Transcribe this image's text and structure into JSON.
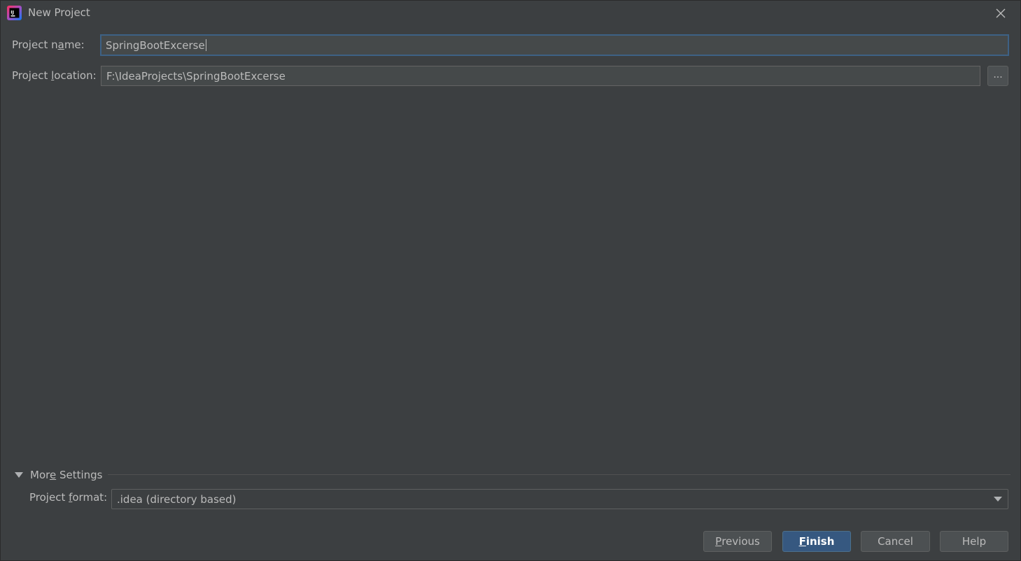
{
  "window": {
    "title": "New Project",
    "app_icon": "intellij-idea-icon",
    "close_icon": "close-icon"
  },
  "form": {
    "name_label_pre": "Project n",
    "name_label_mn": "a",
    "name_label_post": "me:",
    "name_value": "SpringBootExcerse",
    "location_label_pre": "Project ",
    "location_label_mn": "l",
    "location_label_post": "ocation:",
    "location_value": "F:\\IdeaProjects\\SpringBootExcerse",
    "browse_label": "..."
  },
  "more_settings": {
    "toggle_pre": "Mor",
    "toggle_mn": "e",
    "toggle_post": " Settings",
    "expanded": true,
    "format_label_pre": "Project ",
    "format_label_mn": "f",
    "format_label_post": "ormat:",
    "format_value": ".idea (directory based)"
  },
  "buttons": {
    "previous_mn": "P",
    "previous_rest": "revious",
    "finish_mn": "F",
    "finish_rest": "inish",
    "cancel": "Cancel",
    "help": "Help"
  },
  "colors": {
    "background": "#3c3f41",
    "focus_border": "#3d6185",
    "primary_button": "#365880"
  }
}
